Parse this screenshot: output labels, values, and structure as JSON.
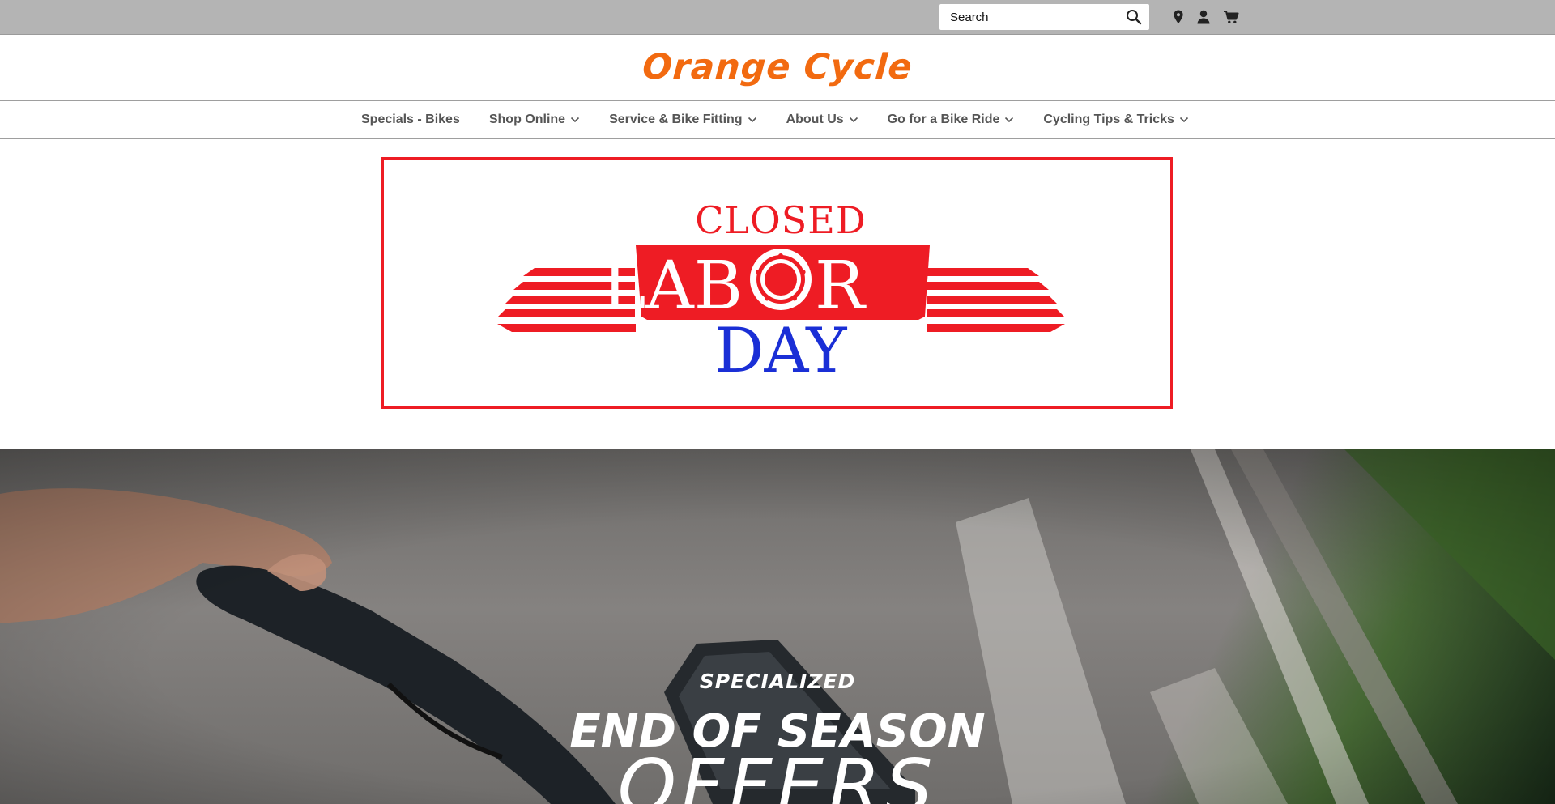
{
  "utility": {
    "search_placeholder": "Search",
    "icons": [
      "search-icon",
      "map-pin-icon",
      "user-icon",
      "cart-icon"
    ]
  },
  "header": {
    "logo_text": "Orange Cycle",
    "logo_color": "#f26a10"
  },
  "nav": {
    "items": [
      {
        "label": "Specials - Bikes",
        "has_dropdown": false
      },
      {
        "label": "Shop Online",
        "has_dropdown": true
      },
      {
        "label": "Service & Bike Fitting",
        "has_dropdown": true
      },
      {
        "label": "About Us",
        "has_dropdown": true
      },
      {
        "label": "Go for a Bike Ride",
        "has_dropdown": true
      },
      {
        "label": "Cycling Tips & Tricks",
        "has_dropdown": true
      }
    ]
  },
  "banner": {
    "line1": "CLOSED",
    "line2_left": "LAB",
    "line2_right": "R",
    "line3": "DAY",
    "red": "#ee1c24",
    "blue": "#1a2fd6"
  },
  "hero": {
    "brand": "SPECIALIZED",
    "title": "END OF SEASON",
    "subtitle": "OFFERS"
  }
}
